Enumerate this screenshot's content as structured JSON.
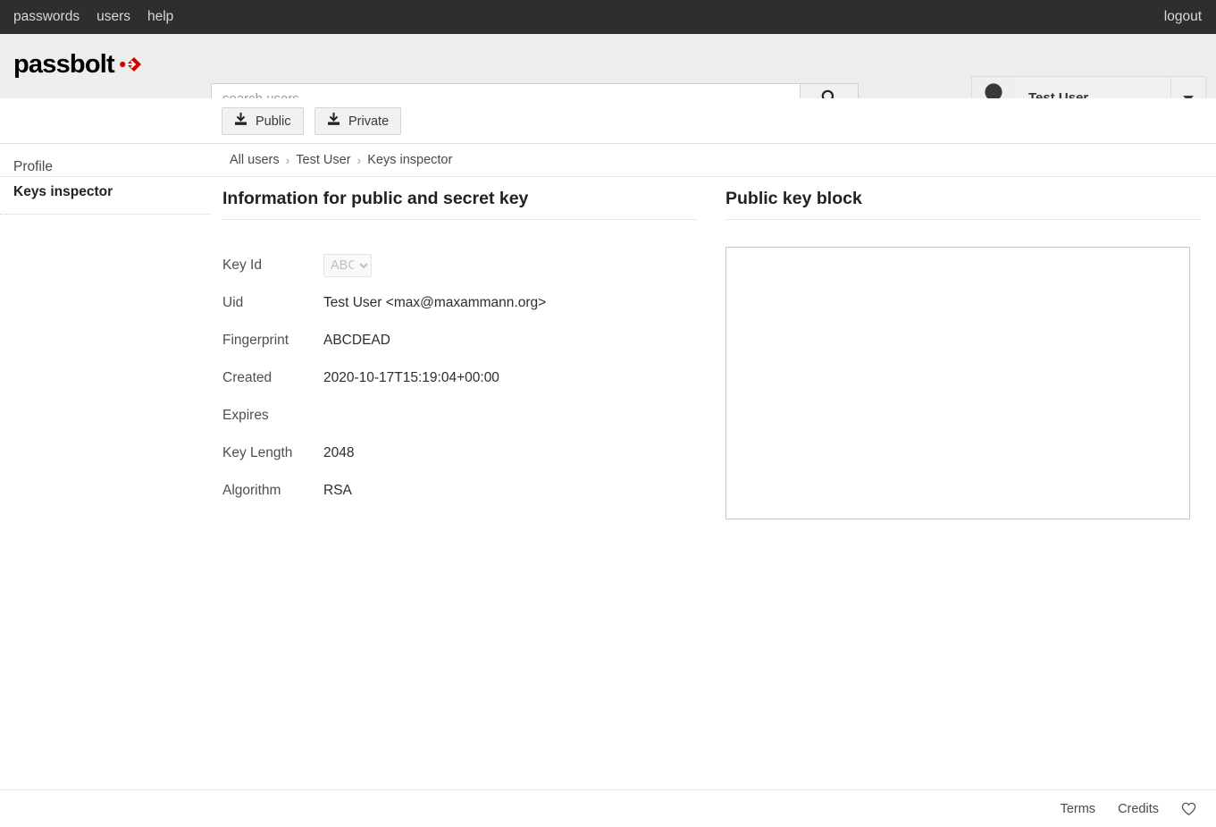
{
  "top_nav": {
    "links": [
      {
        "label": "passwords",
        "name": "nav-passwords"
      },
      {
        "label": "users",
        "name": "nav-users"
      },
      {
        "label": "help",
        "name": "nav-help"
      }
    ],
    "logout_label": "logout"
  },
  "header": {
    "logo_text": "passbolt",
    "logo_icon": "passbolt-arrow-mark",
    "search": {
      "placeholder": "search users",
      "value": "",
      "button_icon": "search-icon"
    },
    "user": {
      "name": "Test User",
      "avatar_icon": "user-avatar",
      "caret_icon": "chevron-down-icon"
    }
  },
  "action_bar": {
    "buttons": [
      {
        "label": "Public",
        "icon": "download-icon",
        "name": "download-public-key-button"
      },
      {
        "label": "Private",
        "icon": "download-icon",
        "name": "download-private-key-button"
      }
    ]
  },
  "breadcrumb": {
    "separator": "›",
    "items": [
      {
        "label": "All users"
      },
      {
        "label": "Test User"
      },
      {
        "label": "Keys inspector"
      }
    ]
  },
  "sidebar": {
    "items": [
      {
        "label": "Profile",
        "active": false
      },
      {
        "label": "Keys inspector",
        "active": true
      }
    ]
  },
  "main": {
    "left": {
      "title": "Information for public and secret key",
      "key_id": {
        "label": "Key Id",
        "selected": "ABC",
        "options": [
          "ABC"
        ],
        "disabled": true
      },
      "rows": [
        {
          "key": "Uid",
          "value": "Test User <max@maxammann.org>"
        },
        {
          "key": "Fingerprint",
          "value": "ABCDEAD"
        },
        {
          "key": "Created",
          "value": "2020-10-17T15:19:04+00:00"
        },
        {
          "key": "Expires",
          "value": ""
        },
        {
          "key": "Key Length",
          "value": "2048"
        },
        {
          "key": "Algorithm",
          "value": "RSA"
        }
      ]
    },
    "right": {
      "title": "Public key block",
      "block_value": ""
    }
  },
  "footer": {
    "links": [
      {
        "label": "Terms"
      },
      {
        "label": "Credits"
      }
    ],
    "heart_icon": "heart-icon"
  },
  "colors": {
    "nav_background": "#2e2e2e",
    "header_background": "#ededed",
    "brand_red": "#d40000",
    "text_primary": "#2d2d2d",
    "text_muted": "#4f4f4f"
  }
}
